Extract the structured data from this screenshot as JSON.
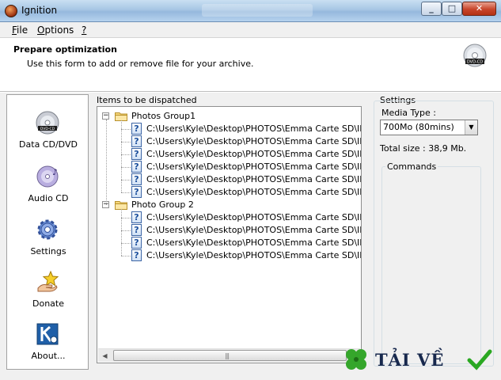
{
  "window": {
    "title": "Ignition"
  },
  "menu": [
    {
      "accel": "F",
      "rest": "ile"
    },
    {
      "accel": "O",
      "rest": "ptions"
    },
    {
      "accel": "?",
      "rest": ""
    }
  ],
  "header": {
    "title": "Prepare optimization",
    "subtitle": "Use this form to add or remove file for your archive."
  },
  "sidebar": {
    "items": [
      {
        "label": "Data CD/DVD",
        "icon": "dvd-disc-icon"
      },
      {
        "label": "Audio CD",
        "icon": "music-disc-icon"
      },
      {
        "label": "Settings",
        "icon": "gear-icon"
      },
      {
        "label": "Donate",
        "icon": "star-hand-icon"
      },
      {
        "label": "About...",
        "icon": "logo-icon"
      }
    ]
  },
  "items_panel": {
    "label": "Items to be dispatched",
    "groups": [
      {
        "name": "Photos Group1",
        "files": [
          "C:\\Users\\Kyle\\Desktop\\PHOTOS\\Emma Carte SD\\IMG_",
          "C:\\Users\\Kyle\\Desktop\\PHOTOS\\Emma Carte SD\\IMG_",
          "C:\\Users\\Kyle\\Desktop\\PHOTOS\\Emma Carte SD\\IMG_",
          "C:\\Users\\Kyle\\Desktop\\PHOTOS\\Emma Carte SD\\IMG_",
          "C:\\Users\\Kyle\\Desktop\\PHOTOS\\Emma Carte SD\\IMG_",
          "C:\\Users\\Kyle\\Desktop\\PHOTOS\\Emma Carte SD\\IMG_"
        ]
      },
      {
        "name": "Photo Group 2",
        "files": [
          "C:\\Users\\Kyle\\Desktop\\PHOTOS\\Emma Carte SD\\IMG_",
          "C:\\Users\\Kyle\\Desktop\\PHOTOS\\Emma Carte SD\\IMG_",
          "C:\\Users\\Kyle\\Desktop\\PHOTOS\\Emma Carte SD\\IMG_",
          "C:\\Users\\Kyle\\Desktop\\PHOTOS\\Emma Carte SD\\IMG_"
        ]
      }
    ],
    "expanded_symbol": "−",
    "file_icon_glyph": "?"
  },
  "settings": {
    "label": "Settings",
    "media_type_label": "Media Type :",
    "media_type_value": "700Mo (80mins)",
    "total_size": "Total size : 38,9 Mb.",
    "commands_label": "Commands"
  },
  "watermark": {
    "text": "TẢI VỀ"
  },
  "colors": {
    "title_bar": "#a7c6e4",
    "close_button": "#c8452a",
    "window_bg": "#f0f0f0"
  }
}
